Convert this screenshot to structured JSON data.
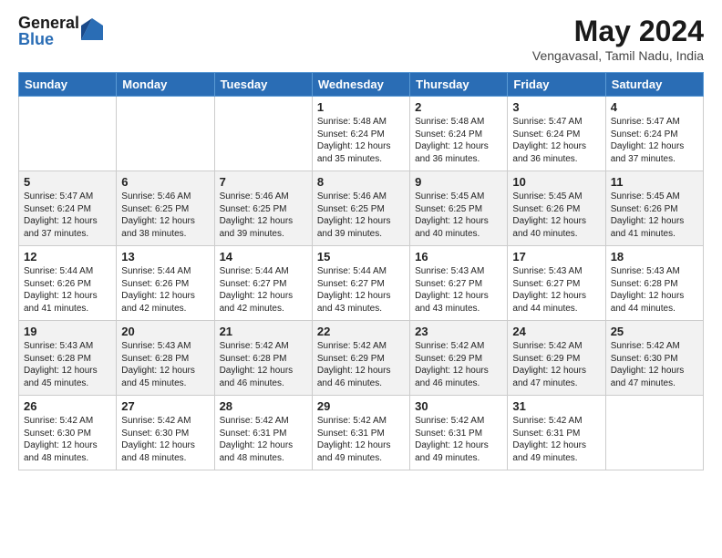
{
  "header": {
    "logo_general": "General",
    "logo_blue": "Blue",
    "month_title": "May 2024",
    "location": "Vengavasal, Tamil Nadu, India"
  },
  "days_of_week": [
    "Sunday",
    "Monday",
    "Tuesday",
    "Wednesday",
    "Thursday",
    "Friday",
    "Saturday"
  ],
  "weeks": [
    [
      {
        "day": "",
        "info": ""
      },
      {
        "day": "",
        "info": ""
      },
      {
        "day": "",
        "info": ""
      },
      {
        "day": "1",
        "info": "Sunrise: 5:48 AM\nSunset: 6:24 PM\nDaylight: 12 hours\nand 35 minutes."
      },
      {
        "day": "2",
        "info": "Sunrise: 5:48 AM\nSunset: 6:24 PM\nDaylight: 12 hours\nand 36 minutes."
      },
      {
        "day": "3",
        "info": "Sunrise: 5:47 AM\nSunset: 6:24 PM\nDaylight: 12 hours\nand 36 minutes."
      },
      {
        "day": "4",
        "info": "Sunrise: 5:47 AM\nSunset: 6:24 PM\nDaylight: 12 hours\nand 37 minutes."
      }
    ],
    [
      {
        "day": "5",
        "info": "Sunrise: 5:47 AM\nSunset: 6:24 PM\nDaylight: 12 hours\nand 37 minutes."
      },
      {
        "day": "6",
        "info": "Sunrise: 5:46 AM\nSunset: 6:25 PM\nDaylight: 12 hours\nand 38 minutes."
      },
      {
        "day": "7",
        "info": "Sunrise: 5:46 AM\nSunset: 6:25 PM\nDaylight: 12 hours\nand 39 minutes."
      },
      {
        "day": "8",
        "info": "Sunrise: 5:46 AM\nSunset: 6:25 PM\nDaylight: 12 hours\nand 39 minutes."
      },
      {
        "day": "9",
        "info": "Sunrise: 5:45 AM\nSunset: 6:25 PM\nDaylight: 12 hours\nand 40 minutes."
      },
      {
        "day": "10",
        "info": "Sunrise: 5:45 AM\nSunset: 6:26 PM\nDaylight: 12 hours\nand 40 minutes."
      },
      {
        "day": "11",
        "info": "Sunrise: 5:45 AM\nSunset: 6:26 PM\nDaylight: 12 hours\nand 41 minutes."
      }
    ],
    [
      {
        "day": "12",
        "info": "Sunrise: 5:44 AM\nSunset: 6:26 PM\nDaylight: 12 hours\nand 41 minutes."
      },
      {
        "day": "13",
        "info": "Sunrise: 5:44 AM\nSunset: 6:26 PM\nDaylight: 12 hours\nand 42 minutes."
      },
      {
        "day": "14",
        "info": "Sunrise: 5:44 AM\nSunset: 6:27 PM\nDaylight: 12 hours\nand 42 minutes."
      },
      {
        "day": "15",
        "info": "Sunrise: 5:44 AM\nSunset: 6:27 PM\nDaylight: 12 hours\nand 43 minutes."
      },
      {
        "day": "16",
        "info": "Sunrise: 5:43 AM\nSunset: 6:27 PM\nDaylight: 12 hours\nand 43 minutes."
      },
      {
        "day": "17",
        "info": "Sunrise: 5:43 AM\nSunset: 6:27 PM\nDaylight: 12 hours\nand 44 minutes."
      },
      {
        "day": "18",
        "info": "Sunrise: 5:43 AM\nSunset: 6:28 PM\nDaylight: 12 hours\nand 44 minutes."
      }
    ],
    [
      {
        "day": "19",
        "info": "Sunrise: 5:43 AM\nSunset: 6:28 PM\nDaylight: 12 hours\nand 45 minutes."
      },
      {
        "day": "20",
        "info": "Sunrise: 5:43 AM\nSunset: 6:28 PM\nDaylight: 12 hours\nand 45 minutes."
      },
      {
        "day": "21",
        "info": "Sunrise: 5:42 AM\nSunset: 6:28 PM\nDaylight: 12 hours\nand 46 minutes."
      },
      {
        "day": "22",
        "info": "Sunrise: 5:42 AM\nSunset: 6:29 PM\nDaylight: 12 hours\nand 46 minutes."
      },
      {
        "day": "23",
        "info": "Sunrise: 5:42 AM\nSunset: 6:29 PM\nDaylight: 12 hours\nand 46 minutes."
      },
      {
        "day": "24",
        "info": "Sunrise: 5:42 AM\nSunset: 6:29 PM\nDaylight: 12 hours\nand 47 minutes."
      },
      {
        "day": "25",
        "info": "Sunrise: 5:42 AM\nSunset: 6:30 PM\nDaylight: 12 hours\nand 47 minutes."
      }
    ],
    [
      {
        "day": "26",
        "info": "Sunrise: 5:42 AM\nSunset: 6:30 PM\nDaylight: 12 hours\nand 48 minutes."
      },
      {
        "day": "27",
        "info": "Sunrise: 5:42 AM\nSunset: 6:30 PM\nDaylight: 12 hours\nand 48 minutes."
      },
      {
        "day": "28",
        "info": "Sunrise: 5:42 AM\nSunset: 6:31 PM\nDaylight: 12 hours\nand 48 minutes."
      },
      {
        "day": "29",
        "info": "Sunrise: 5:42 AM\nSunset: 6:31 PM\nDaylight: 12 hours\nand 49 minutes."
      },
      {
        "day": "30",
        "info": "Sunrise: 5:42 AM\nSunset: 6:31 PM\nDaylight: 12 hours\nand 49 minutes."
      },
      {
        "day": "31",
        "info": "Sunrise: 5:42 AM\nSunset: 6:31 PM\nDaylight: 12 hours\nand 49 minutes."
      },
      {
        "day": "",
        "info": ""
      }
    ]
  ]
}
